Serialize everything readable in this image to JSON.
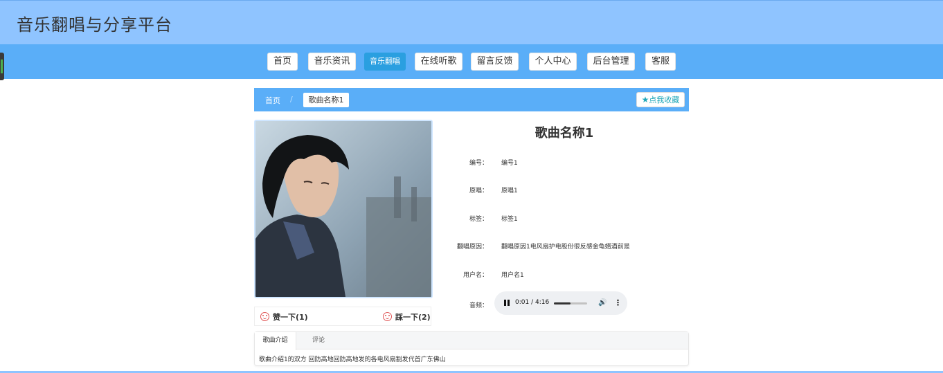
{
  "header": {
    "site_title": "音乐翻唱与分享平台"
  },
  "nav": {
    "items": [
      {
        "label": "首页",
        "active": false
      },
      {
        "label": "音乐资讯",
        "active": false
      },
      {
        "label": "音乐翻唱",
        "active": true
      },
      {
        "label": "在线听歌",
        "active": false
      },
      {
        "label": "留言反馈",
        "active": false
      },
      {
        "label": "个人中心",
        "active": false
      },
      {
        "label": "后台管理",
        "active": false
      },
      {
        "label": "客服",
        "active": false
      }
    ]
  },
  "breadcrumb": {
    "home": "首页",
    "separator": "/",
    "current": "歌曲名称1",
    "favorite_label": "点我收藏"
  },
  "song": {
    "title": "歌曲名称1",
    "fields": [
      {
        "label": "编号：",
        "value": "编号1"
      },
      {
        "label": "原唱：",
        "value": "原唱1"
      },
      {
        "label": "标签：",
        "value": "标签1"
      },
      {
        "label": "翻唱原因：",
        "value": "翻唱原因1电风扇护电股份很反感金龟婿酒前是"
      },
      {
        "label": "用户名：",
        "value": "用户名1"
      }
    ],
    "audio_label": "音频："
  },
  "audio_player": {
    "state": "paused",
    "current_time": "0:01",
    "duration": "4:16",
    "time_text": "0:01 / 4:16",
    "progress": 0.5
  },
  "votes": {
    "up_label": "赞一下(1)",
    "down_label": "踩一下(2)"
  },
  "tabs": {
    "items": [
      {
        "label": "歌曲介绍",
        "active": true
      },
      {
        "label": "评论",
        "active": false
      }
    ],
    "content": "歌曲介绍1的双方 回防高地回防高地发的各电风扇割发代首广东佛山"
  },
  "colors": {
    "header_bg": "#8fc4ff",
    "nav_bg": "#5aaef8",
    "active_nav": "#2a9fe0",
    "accent_teal": "#20a7b8",
    "vote_red": "#e05555"
  }
}
